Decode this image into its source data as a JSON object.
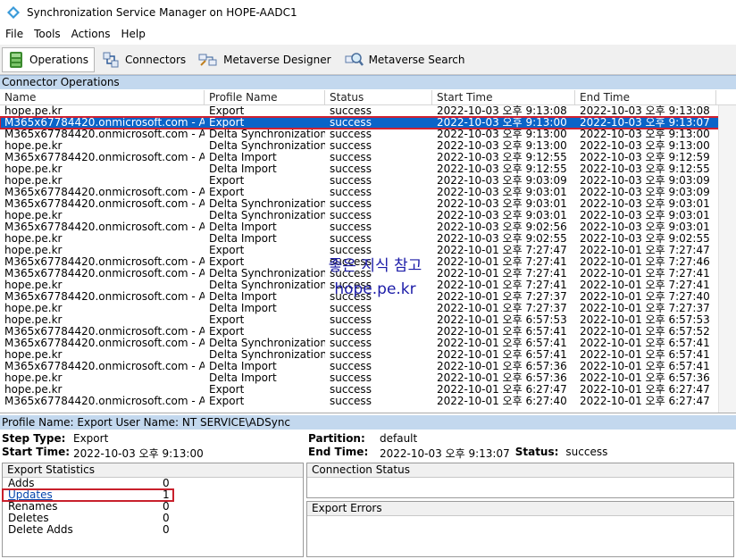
{
  "window": {
    "title": "Synchronization Service Manager on HOPE-AADC1"
  },
  "menu": {
    "items": [
      "File",
      "Tools",
      "Actions",
      "Help"
    ]
  },
  "toolbar": {
    "operations": "Operations",
    "connectors": "Connectors",
    "metaverse_designer": "Metaverse Designer",
    "metaverse_search": "Metaverse Search"
  },
  "connector_operations": {
    "header": "Connector Operations",
    "columns": [
      "Name",
      "Profile Name",
      "Status",
      "Start Time",
      "End Time"
    ],
    "rows": [
      [
        "hope.pe.kr",
        "Export",
        "success",
        "2022-10-03 오후 9:13:08",
        "2022-10-03 오후 9:13:08"
      ],
      [
        "M365x67784420.onmicrosoft.com - AAD",
        "Export",
        "success",
        "2022-10-03 오후 9:13:00",
        "2022-10-03 오후 9:13:07"
      ],
      [
        "M365x67784420.onmicrosoft.com - AAD",
        "Delta Synchronization",
        "success",
        "2022-10-03 오후 9:13:00",
        "2022-10-03 오후 9:13:00"
      ],
      [
        "hope.pe.kr",
        "Delta Synchronization",
        "success",
        "2022-10-03 오후 9:13:00",
        "2022-10-03 오후 9:13:00"
      ],
      [
        "M365x67784420.onmicrosoft.com - AAD",
        "Delta Import",
        "success",
        "2022-10-03 오후 9:12:55",
        "2022-10-03 오후 9:12:59"
      ],
      [
        "hope.pe.kr",
        "Delta Import",
        "success",
        "2022-10-03 오후 9:12:55",
        "2022-10-03 오후 9:12:55"
      ],
      [
        "hope.pe.kr",
        "Export",
        "success",
        "2022-10-03 오후 9:03:09",
        "2022-10-03 오후 9:03:09"
      ],
      [
        "M365x67784420.onmicrosoft.com - AAD",
        "Export",
        "success",
        "2022-10-03 오후 9:03:01",
        "2022-10-03 오후 9:03:09"
      ],
      [
        "M365x67784420.onmicrosoft.com - AAD",
        "Delta Synchronization",
        "success",
        "2022-10-03 오후 9:03:01",
        "2022-10-03 오후 9:03:01"
      ],
      [
        "hope.pe.kr",
        "Delta Synchronization",
        "success",
        "2022-10-03 오후 9:03:01",
        "2022-10-03 오후 9:03:01"
      ],
      [
        "M365x67784420.onmicrosoft.com - AAD",
        "Delta Import",
        "success",
        "2022-10-03 오후 9:02:56",
        "2022-10-03 오후 9:03:01"
      ],
      [
        "hope.pe.kr",
        "Delta Import",
        "success",
        "2022-10-03 오후 9:02:55",
        "2022-10-03 오후 9:02:55"
      ],
      [
        "hope.pe.kr",
        "Export",
        "success",
        "2022-10-01 오후 7:27:47",
        "2022-10-01 오후 7:27:47"
      ],
      [
        "M365x67784420.onmicrosoft.com - AAD",
        "Export",
        "success",
        "2022-10-01 오후 7:27:41",
        "2022-10-01 오후 7:27:46"
      ],
      [
        "M365x67784420.onmicrosoft.com - AAD",
        "Delta Synchronization",
        "success",
        "2022-10-01 오후 7:27:41",
        "2022-10-01 오후 7:27:41"
      ],
      [
        "hope.pe.kr",
        "Delta Synchronization",
        "success",
        "2022-10-01 오후 7:27:41",
        "2022-10-01 오후 7:27:41"
      ],
      [
        "M365x67784420.onmicrosoft.com - AAD",
        "Delta Import",
        "success",
        "2022-10-01 오후 7:27:37",
        "2022-10-01 오후 7:27:40"
      ],
      [
        "hope.pe.kr",
        "Delta Import",
        "success",
        "2022-10-01 오후 7:27:37",
        "2022-10-01 오후 7:27:37"
      ],
      [
        "hope.pe.kr",
        "Export",
        "success",
        "2022-10-01 오후 6:57:53",
        "2022-10-01 오후 6:57:53"
      ],
      [
        "M365x67784420.onmicrosoft.com - AAD",
        "Export",
        "success",
        "2022-10-01 오후 6:57:41",
        "2022-10-01 오후 6:57:52"
      ],
      [
        "M365x67784420.onmicrosoft.com - AAD",
        "Delta Synchronization",
        "success",
        "2022-10-01 오후 6:57:41",
        "2022-10-01 오후 6:57:41"
      ],
      [
        "hope.pe.kr",
        "Delta Synchronization",
        "success",
        "2022-10-01 오후 6:57:41",
        "2022-10-01 오후 6:57:41"
      ],
      [
        "M365x67784420.onmicrosoft.com - AAD",
        "Delta Import",
        "success",
        "2022-10-01 오후 6:57:36",
        "2022-10-01 오후 6:57:41"
      ],
      [
        "hope.pe.kr",
        "Delta Import",
        "success",
        "2022-10-01 오후 6:57:36",
        "2022-10-01 오후 6:57:36"
      ],
      [
        "hope.pe.kr",
        "Export",
        "success",
        "2022-10-01 오후 6:27:47",
        "2022-10-01 오후 6:27:47"
      ],
      [
        "M365x67784420.onmicrosoft.com - AAD",
        "Export",
        "success",
        "2022-10-01 오후 6:27:40",
        "2022-10-01 오후 6:27:47"
      ]
    ],
    "selected_index": 1
  },
  "watermark": {
    "line1": "좋은 지식 참고",
    "line2": "hope.pe.kr"
  },
  "profile": {
    "summary": "Profile Name: Export  User Name: NT SERVICE\\ADSync",
    "step_type_label": "Step Type:",
    "step_type": "Export",
    "start_time_label": "Start Time:",
    "start_time": "2022-10-03 오후 9:13:00",
    "partition_label": "Partition:",
    "partition": "default",
    "end_time_label": "End Time:",
    "end_time": "2022-10-03 오후 9:13:07",
    "status_label": "Status:",
    "status": "success"
  },
  "export_statistics": {
    "header": "Export Statistics",
    "items": [
      {
        "name": "Adds",
        "value": "0"
      },
      {
        "name": "Updates",
        "value": "1"
      },
      {
        "name": "Renames",
        "value": "0"
      },
      {
        "name": "Deletes",
        "value": "0"
      },
      {
        "name": "Delete Adds",
        "value": "0"
      }
    ]
  },
  "connection_status": {
    "header": "Connection Status"
  },
  "export_errors": {
    "header": "Export Errors"
  },
  "colors": {
    "selection": "#0a64c8",
    "highlight_border": "#c8202c",
    "section_header": "#c3d8ee"
  }
}
